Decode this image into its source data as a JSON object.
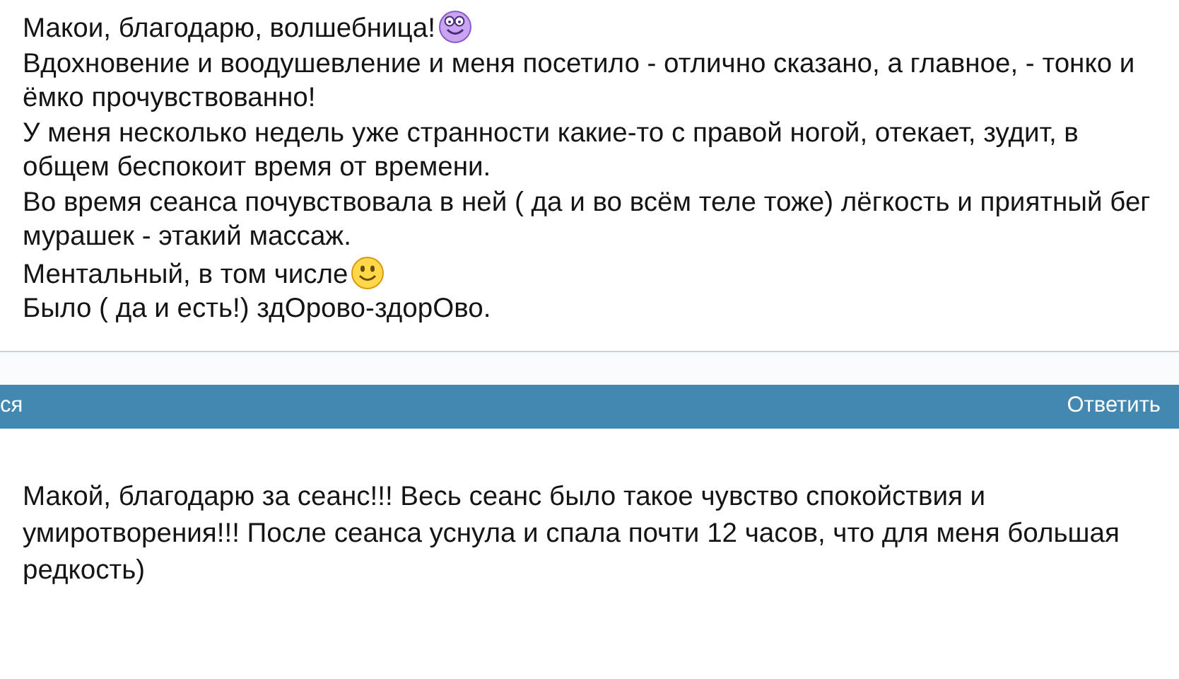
{
  "posts": [
    {
      "lines": [
        {
          "text": "Макои, благодарю, волшебница!",
          "color": "#c9a4f0"
        },
        {
          "text": "Вдохновение и воодушевление и меня посетило - отлично сказано, а главное, - тонко и ёмко прочувствованно!"
        },
        {
          "text": "У меня несколько недель уже странности какие-то с правой ногой, отекает, зудит, в общем беспокоит время от времени."
        },
        {
          "text": "Во время сеанса почувствовала в ней ( да и во всём теле тоже) лёгкость и приятный бег мурашек - этакий массаж."
        },
        {
          "text": "Ментальный, в том числе",
          "color": "#ffd84a"
        },
        {
          "text": "Было ( да и есть!) здОрово-здорОво."
        }
      ],
      "actions": {
        "left": "ся",
        "right": "Ответить"
      }
    },
    {
      "lines": [
        {
          "text": "Макой, благодарю за сеанс!!! Весь сеанс было такое чувство спокойствия и умиротворения!!! После сеанса уснула и спала почти 12 часов, что для меня большая редкость)"
        }
      ]
    }
  ]
}
